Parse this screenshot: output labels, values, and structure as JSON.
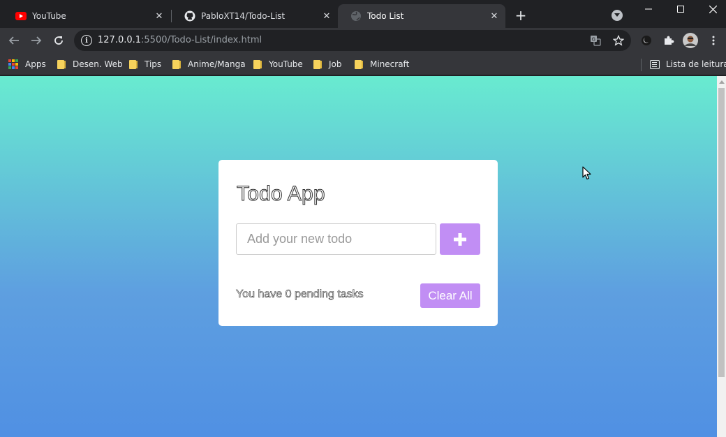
{
  "browser": {
    "tabs": [
      {
        "title": "YouTube",
        "icon": "youtube-icon",
        "active": false
      },
      {
        "title": "PabloXT14/Todo-List",
        "icon": "github-icon",
        "active": false
      },
      {
        "title": "Todo List",
        "icon": "globe-icon",
        "active": true
      }
    ],
    "new_tab_symbol": "+",
    "close_symbol": "✕",
    "address": {
      "host": "127.0.0.1",
      "path": ":5500/Todo-List/index.html"
    },
    "bookmarks": [
      {
        "label": "Apps",
        "icon": "apps-grid-icon"
      },
      {
        "label": "Desen. Web",
        "icon": "folder-icon"
      },
      {
        "label": "Tips",
        "icon": "folder-icon"
      },
      {
        "label": "Anime/Manga",
        "icon": "folder-icon"
      },
      {
        "label": "YouTube",
        "icon": "folder-icon"
      },
      {
        "label": "Job",
        "icon": "folder-icon"
      },
      {
        "label": "Minecraft",
        "icon": "folder-icon"
      }
    ],
    "reading_list": {
      "label": "Lista de leitura",
      "icon": "reading-list-icon"
    }
  },
  "app": {
    "title": "Todo App",
    "input_placeholder": "Add your new todo",
    "input_value": "",
    "add_button_icon": "plus-icon",
    "pending_prefix": "You have ",
    "pending_count": "0",
    "pending_suffix": " pending tasks",
    "clear_label": "Clear All"
  },
  "colors": {
    "accent": "#c18ef4",
    "gradient_top": "#68ebd0",
    "gradient_bottom": "#5090e3",
    "browser_dark": "#202124",
    "toolbar": "#35363a"
  }
}
